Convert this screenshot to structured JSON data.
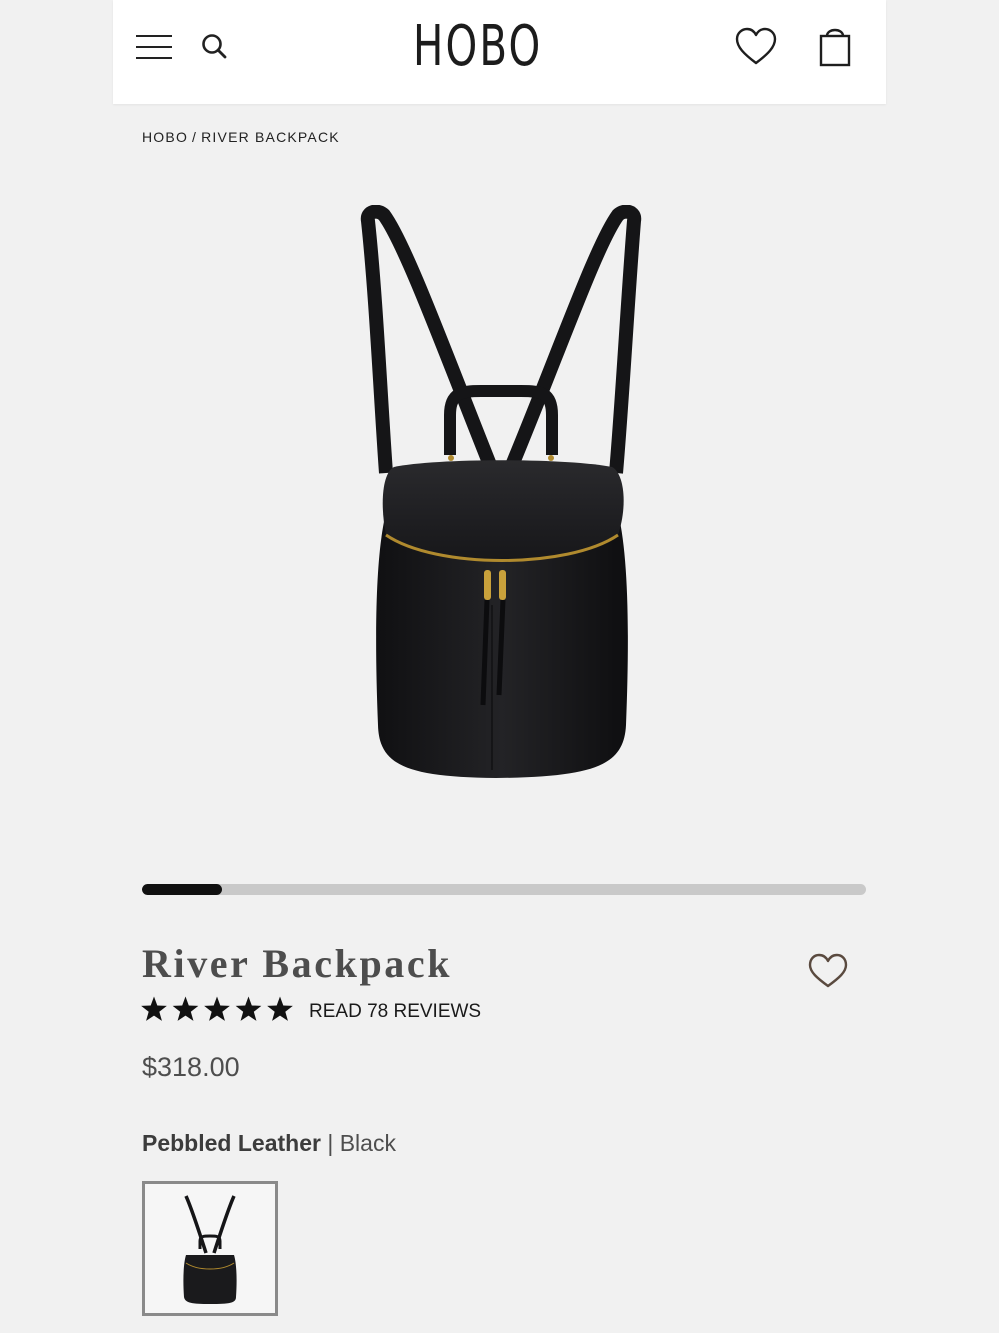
{
  "header": {
    "logo": "HOBO",
    "icons": [
      "menu-icon",
      "search-icon",
      "heart-icon",
      "shopping-bag-icon"
    ]
  },
  "breadcrumb": {
    "home": "HOBO",
    "separator": "/",
    "current": "RIVER BACKPACK"
  },
  "gallery": {
    "progress": 0.11
  },
  "product": {
    "title": "River Backpack",
    "rating": 5,
    "reviews_link": "READ 78 REVIEWS",
    "price": "$318.00",
    "material": "Pebbled Leather",
    "material_separator": " | ",
    "color": "Black",
    "swatches": [
      "Black"
    ]
  },
  "colors": {
    "background": "#f1f1f1",
    "header": "#ffffff",
    "text": "#222222",
    "progress_fill": "#111111",
    "progress_track": "#c9c9c9",
    "bag": "#1b1b1d",
    "zipper": "#b08a2e",
    "heart_outline": "#5a4a3f"
  }
}
